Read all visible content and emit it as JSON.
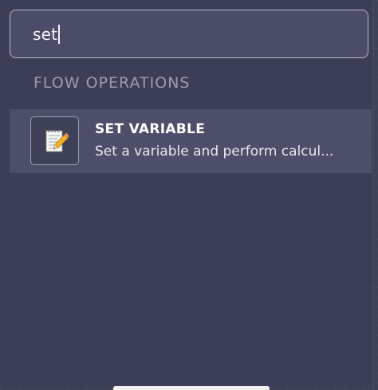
{
  "search": {
    "value": "set"
  },
  "results": {
    "section_title": "FLOW OPERATIONS",
    "items": [
      {
        "icon": "notepad-pencil-icon",
        "title": "SET VARIABLE",
        "description": "Set a variable and perform calcul..."
      }
    ]
  },
  "colors": {
    "panel": "#3c3d57",
    "highlight_row": "#4d4f6a",
    "search_border": "#b6b8c8"
  }
}
